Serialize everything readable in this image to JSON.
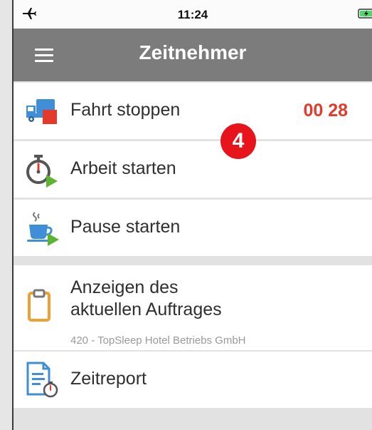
{
  "status_bar": {
    "time": "11:24",
    "airplane_icon": "airplane-icon",
    "battery_icon": "battery-charging-icon"
  },
  "header": {
    "title": "Zeitnehmer",
    "menu_icon": "hamburger-menu-icon"
  },
  "actions": {
    "drive": {
      "label": "Fahrt stoppen",
      "timer": "00 28",
      "icon": "delivery-truck-stop-icon"
    },
    "work": {
      "label": "Arbeit starten",
      "icon": "stopwatch-play-icon"
    },
    "pause": {
      "label": "Pause starten",
      "icon": "coffee-cup-play-icon"
    }
  },
  "badge": {
    "value": "4",
    "color": "#e8141b"
  },
  "order": {
    "label_line1": "Anzeigen des",
    "label_line2": "aktuellen Auftrages",
    "subtitle": "420 - TopSleep Hotel Betriebs GmbH",
    "icon": "clipboard-icon"
  },
  "report": {
    "label": "Zeitreport",
    "icon": "document-timer-icon"
  },
  "colors": {
    "header": "#7c7c7c",
    "accent_red": "#e23a2b",
    "play_green": "#5cb531",
    "icon_blue": "#3f8fd8",
    "clipboard_orange": "#f0a030"
  }
}
